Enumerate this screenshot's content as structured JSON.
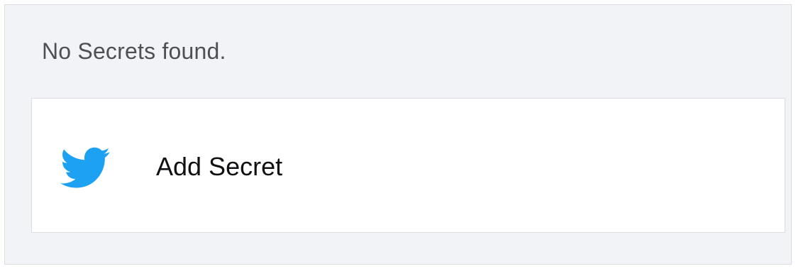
{
  "empty_state": {
    "message": "No Secrets found."
  },
  "add_secret": {
    "label": "Add Secret",
    "icon": "twitter-bird-icon",
    "icon_color": "#1da1f2"
  },
  "colors": {
    "panel_background": "#f2f3f7",
    "card_background": "#ffffff",
    "border": "#dcdde2"
  }
}
